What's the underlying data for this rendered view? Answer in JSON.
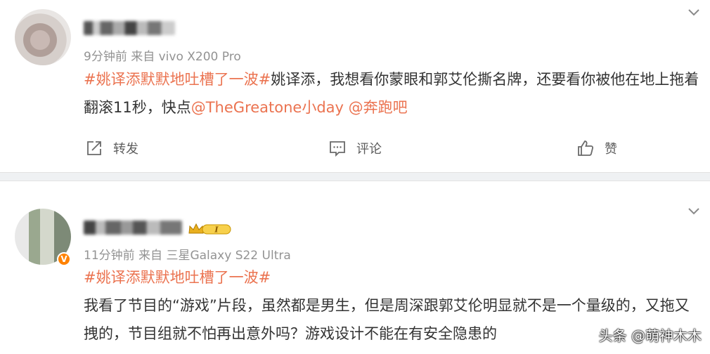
{
  "posts": [
    {
      "meta": "9分钟前  来自 vivo X200 Pro",
      "hashtag": "#姚译添默默地吐槽了一波#",
      "text_a": "姚译添，我想看你蒙眼和郭艾伦撕名牌，还要看你被他在地上拖着翻滚11秒，快点",
      "mention1": "@TheGreatone小day",
      "mention2": "@奔跑吧",
      "actions": {
        "forward": "转发",
        "comment": "评论",
        "like": "赞"
      }
    },
    {
      "meta": "11分钟前  来自 三星Galaxy S22 Ultra",
      "hashtag": "#姚译添默默地吐槽了一波#",
      "text_a": "我看了节目的“游戏”片段，虽然都是男生，但是周深跟郭艾伦明显就不是一个量级的，又拖又拽的，节目组就不怕再出意外吗？游戏设计不能在有安全隐患的",
      "badge_level": "I",
      "verified": "V"
    }
  ],
  "watermark": "头条 @萌神木木",
  "colors": {
    "accent": "#eb7350",
    "meta": "#939393",
    "text": "#333333"
  },
  "icons": [
    "chevron-down-icon",
    "forward-icon",
    "comment-icon",
    "like-icon",
    "crown-badge-icon",
    "verified-icon"
  ]
}
